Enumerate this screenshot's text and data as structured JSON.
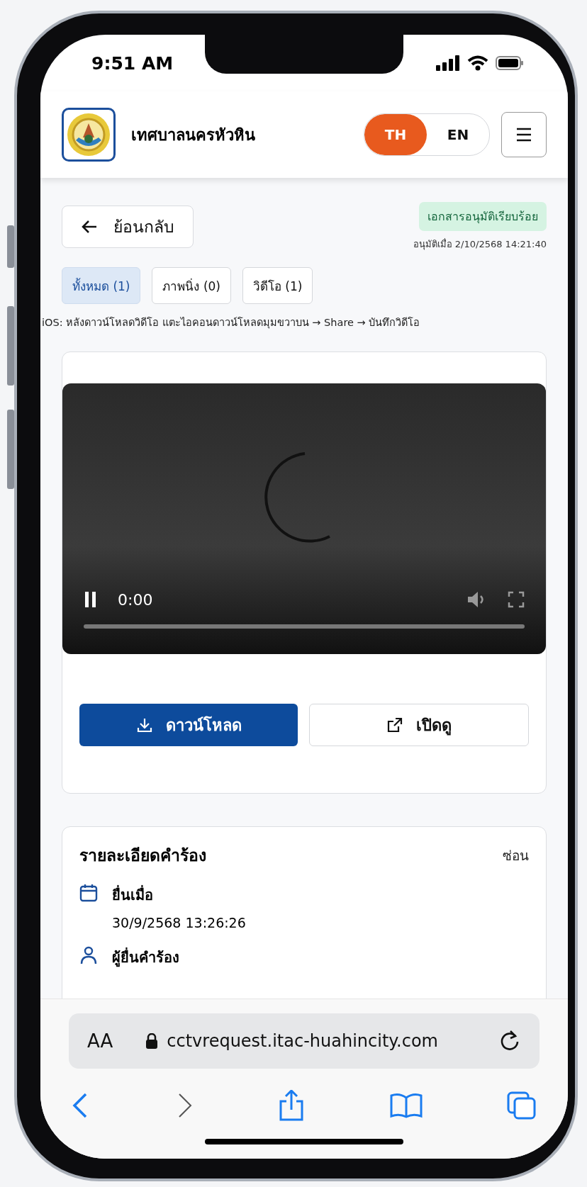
{
  "status_bar": {
    "time": "9:51 AM"
  },
  "header": {
    "title": "เทศบาลนครหัวหิน",
    "languages": [
      {
        "label": "TH",
        "selected": true
      },
      {
        "label": "EN",
        "selected": false
      }
    ]
  },
  "back_button": {
    "label": "ย้อนกลับ"
  },
  "approval": {
    "badge": "เอกสารอนุมัติเรียบร้อย",
    "time": "อนุมัติเมื่อ 2/10/2568 14:21:40"
  },
  "filter_tabs": [
    {
      "label": "ทั้งหมด (1)",
      "selected": true
    },
    {
      "label": "ภาพนิ่ง (0)",
      "selected": false
    },
    {
      "label": "วิดีโอ (1)",
      "selected": false
    }
  ],
  "hint": "iOS: หลังดาวน์โหลดวิดีโอ แตะไอคอนดาวน์โหลดมุมขวาบน → Share → บันทึกวิดีโอ",
  "video": {
    "time": "0:00",
    "playing": true
  },
  "actions": [
    {
      "label": "ดาวน์โหลด",
      "kind": "download"
    },
    {
      "label": "เปิดดู",
      "kind": "open"
    }
  ],
  "details": {
    "title": "รายละเอียดคำร้อง",
    "toggle": "ซ่อน",
    "items": [
      {
        "kind": "date",
        "label": "ยื่นเมื่อ",
        "value": "30/9/2568 13:26:26"
      },
      {
        "kind": "person",
        "label": "ผู้ยื่นคำร้อง"
      }
    ]
  },
  "browser": {
    "text_size": "AA",
    "url": "cctvrequest.itac-huahincity.com"
  }
}
